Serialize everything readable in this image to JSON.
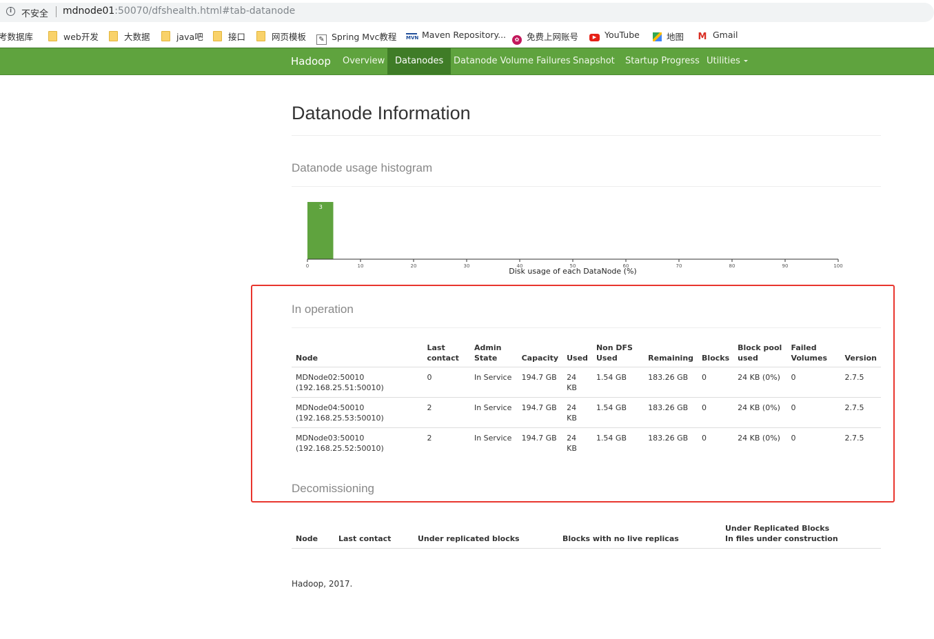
{
  "browser": {
    "security_label": "不安全",
    "url_host": "mdnode01",
    "url_rest": ":50070/dfshealth.html#tab-datanode"
  },
  "bookmarks": [
    {
      "label": "考数据库",
      "icon": "folder-icon"
    },
    {
      "label": "web开发",
      "icon": "folder-icon"
    },
    {
      "label": "大数据",
      "icon": "folder-icon"
    },
    {
      "label": "java吧",
      "icon": "folder-icon"
    },
    {
      "label": "接口",
      "icon": "folder-icon"
    },
    {
      "label": "网页模板",
      "icon": "folder-icon"
    },
    {
      "label": "Spring Mvc教程",
      "icon": "bookmark-page-icon"
    },
    {
      "label": "Maven Repository...",
      "icon": "maven-icon"
    },
    {
      "label": "免费上网账号",
      "icon": "bookmark-site-icon"
    },
    {
      "label": "YouTube",
      "icon": "youtube-icon"
    },
    {
      "label": "地图",
      "icon": "maps-icon"
    },
    {
      "label": "Gmail",
      "icon": "gmail-icon"
    }
  ],
  "nav": {
    "brand": "Hadoop",
    "items": [
      "Overview",
      "Datanodes",
      "Datanode Volume Failures",
      "Snapshot",
      "Startup Progress",
      "Utilities"
    ],
    "active": "Datanodes",
    "accent_color": "#5fa33e"
  },
  "page": {
    "title": "Datanode Information",
    "histogram_heading": "Datanode usage histogram",
    "in_operation_heading": "In operation",
    "decommissioning_heading": "Decomissioning",
    "footer": "Hadoop, 2017."
  },
  "chart_data": {
    "type": "bar",
    "xlabel": "Disk usage of each DataNode (%)",
    "xlim": [
      0,
      100
    ],
    "xticks": [
      0,
      10,
      20,
      30,
      40,
      50,
      60,
      70,
      80,
      90,
      100
    ],
    "bins": [
      {
        "x0": 0,
        "x1": 5,
        "count": 3
      }
    ],
    "ymax": 3,
    "bar_color": "#5fa33e"
  },
  "in_operation": {
    "columns": [
      [
        "Node"
      ],
      [
        "Last",
        "contact"
      ],
      [
        "Admin",
        "State"
      ],
      [
        "Capacity"
      ],
      [
        "Used"
      ],
      [
        "Non DFS",
        "Used"
      ],
      [
        "Remaining"
      ],
      [
        "Blocks"
      ],
      [
        "Block pool",
        "used"
      ],
      [
        "Failed",
        "Volumes"
      ],
      [
        "Version"
      ]
    ],
    "rows": [
      {
        "node": [
          "MDNode02:50010",
          "(192.168.25.51:50010)"
        ],
        "last_contact": "0",
        "admin_state": "In Service",
        "capacity": "194.7 GB",
        "used": [
          "24",
          "KB"
        ],
        "non_dfs_used": "1.54 GB",
        "remaining": "183.26 GB",
        "blocks": "0",
        "block_pool_used": "24 KB (0%)",
        "failed_volumes": "0",
        "version": "2.7.5"
      },
      {
        "node": [
          "MDNode04:50010",
          "(192.168.25.53:50010)"
        ],
        "last_contact": "2",
        "admin_state": "In Service",
        "capacity": "194.7 GB",
        "used": [
          "24",
          "KB"
        ],
        "non_dfs_used": "1.54 GB",
        "remaining": "183.26 GB",
        "blocks": "0",
        "block_pool_used": "24 KB (0%)",
        "failed_volumes": "0",
        "version": "2.7.5"
      },
      {
        "node": [
          "MDNode03:50010",
          "(192.168.25.52:50010)"
        ],
        "last_contact": "2",
        "admin_state": "In Service",
        "capacity": "194.7 GB",
        "used": [
          "24",
          "KB"
        ],
        "non_dfs_used": "1.54 GB",
        "remaining": "183.26 GB",
        "blocks": "0",
        "block_pool_used": "24 KB (0%)",
        "failed_volumes": "0",
        "version": "2.7.5"
      }
    ]
  },
  "decommissioning": {
    "columns": [
      [
        "Node"
      ],
      [
        "Last contact"
      ],
      [
        "Under replicated blocks"
      ],
      [
        "Blocks with no live replicas"
      ],
      [
        "Under Replicated Blocks",
        "In files under construction"
      ]
    ]
  },
  "annotation": {
    "highlight_color": "#e8352d"
  }
}
